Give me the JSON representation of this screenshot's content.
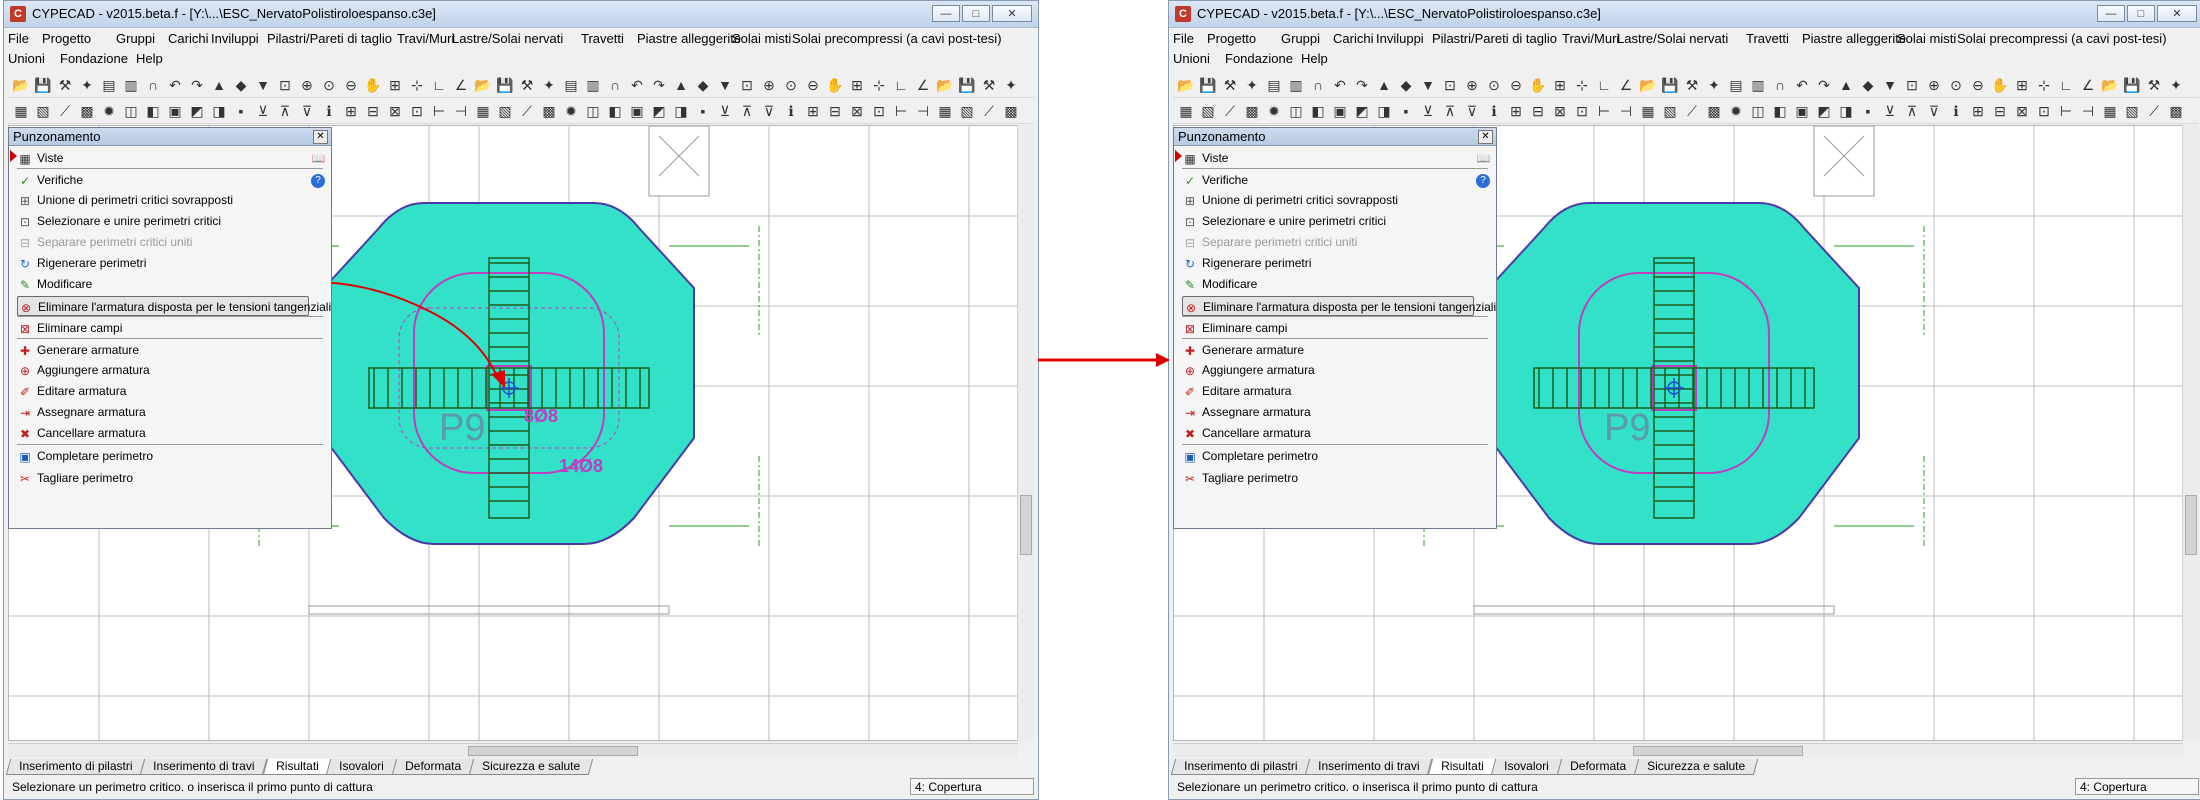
{
  "window": {
    "title": "CYPECAD - v2015.beta.f - [Y:\\...\\ESC_NervatoPolistiroloespanso.c3e]",
    "buttons": [
      "—",
      "□",
      "✕"
    ]
  },
  "menu": {
    "row1": [
      "File",
      "Progetto",
      "Gruppi",
      "Carichi",
      "Inviluppi",
      "Pilastri/Pareti di taglio",
      "Travi/Muri",
      "Lastre/Solai nervati",
      "Travetti",
      "Piastre alleggerite",
      "Solai misti",
      "Solai precompressi (a cavi post-tesi)"
    ],
    "row2": [
      "Unioni",
      "Fondazione",
      "Help"
    ]
  },
  "panel": {
    "title": "Punzonamento",
    "items": [
      {
        "label": "Viste",
        "icon": "views-icon"
      },
      {
        "label": "Verifiche",
        "icon": "check-icon"
      },
      {
        "label": "Unione di perimetri critici sovrapposti",
        "icon": "merge-perimeters-icon"
      },
      {
        "label": "Selezionare e unire perimetri critici",
        "icon": "select-merge-icon"
      },
      {
        "label": "Separare perimetri critici uniti",
        "icon": "separate-icon",
        "disabled": true
      },
      {
        "label": "Rigenerare perimetri",
        "icon": "regenerate-icon"
      },
      {
        "label": "Modificare",
        "icon": "modify-icon"
      },
      {
        "label": "Eliminare l'armatura disposta per le tensioni tangenziali",
        "icon": "delete-shear-reinforcement-icon",
        "selected": true
      },
      {
        "label": "Eliminare campi",
        "icon": "delete-fields-icon"
      },
      {
        "label": "Generare armature",
        "icon": "generate-reinforcement-icon"
      },
      {
        "label": "Aggiungere armatura",
        "icon": "add-reinforcement-icon"
      },
      {
        "label": "Editare armatura",
        "icon": "edit-reinforcement-icon"
      },
      {
        "label": "Assegnare armatura",
        "icon": "assign-reinforcement-icon"
      },
      {
        "label": "Cancellare armatura",
        "icon": "cancel-reinforcement-icon"
      },
      {
        "label": "Completare perimetro",
        "icon": "complete-perimeter-icon"
      },
      {
        "label": "Tagliare perimetro",
        "icon": "cut-perimeter-icon"
      }
    ]
  },
  "drawing": {
    "column_label": "P9",
    "rebar_labels_before": [
      "8Ø8",
      "14Ø8"
    ]
  },
  "tabs": [
    {
      "label": "Inserimento di pilastri",
      "active": false
    },
    {
      "label": "Inserimento di travi",
      "active": false
    },
    {
      "label": "Risultati",
      "active": true
    },
    {
      "label": "Isovalori",
      "active": false
    },
    {
      "label": "Deformata",
      "active": false
    },
    {
      "label": "Sicurezza e salute",
      "active": false
    }
  ],
  "status": {
    "message": "Selezionare un perimetro critico. o inserisca il primo punto di cattura",
    "group": "4: Copertura"
  },
  "colors": {
    "slab_fill": "#33e0c8",
    "slab_edge": "#4a3aa8",
    "perimeter": "#c03cc0",
    "rebar": "#1a5e1a",
    "dim_lines": "#21a021",
    "arrow": "#e00000"
  }
}
